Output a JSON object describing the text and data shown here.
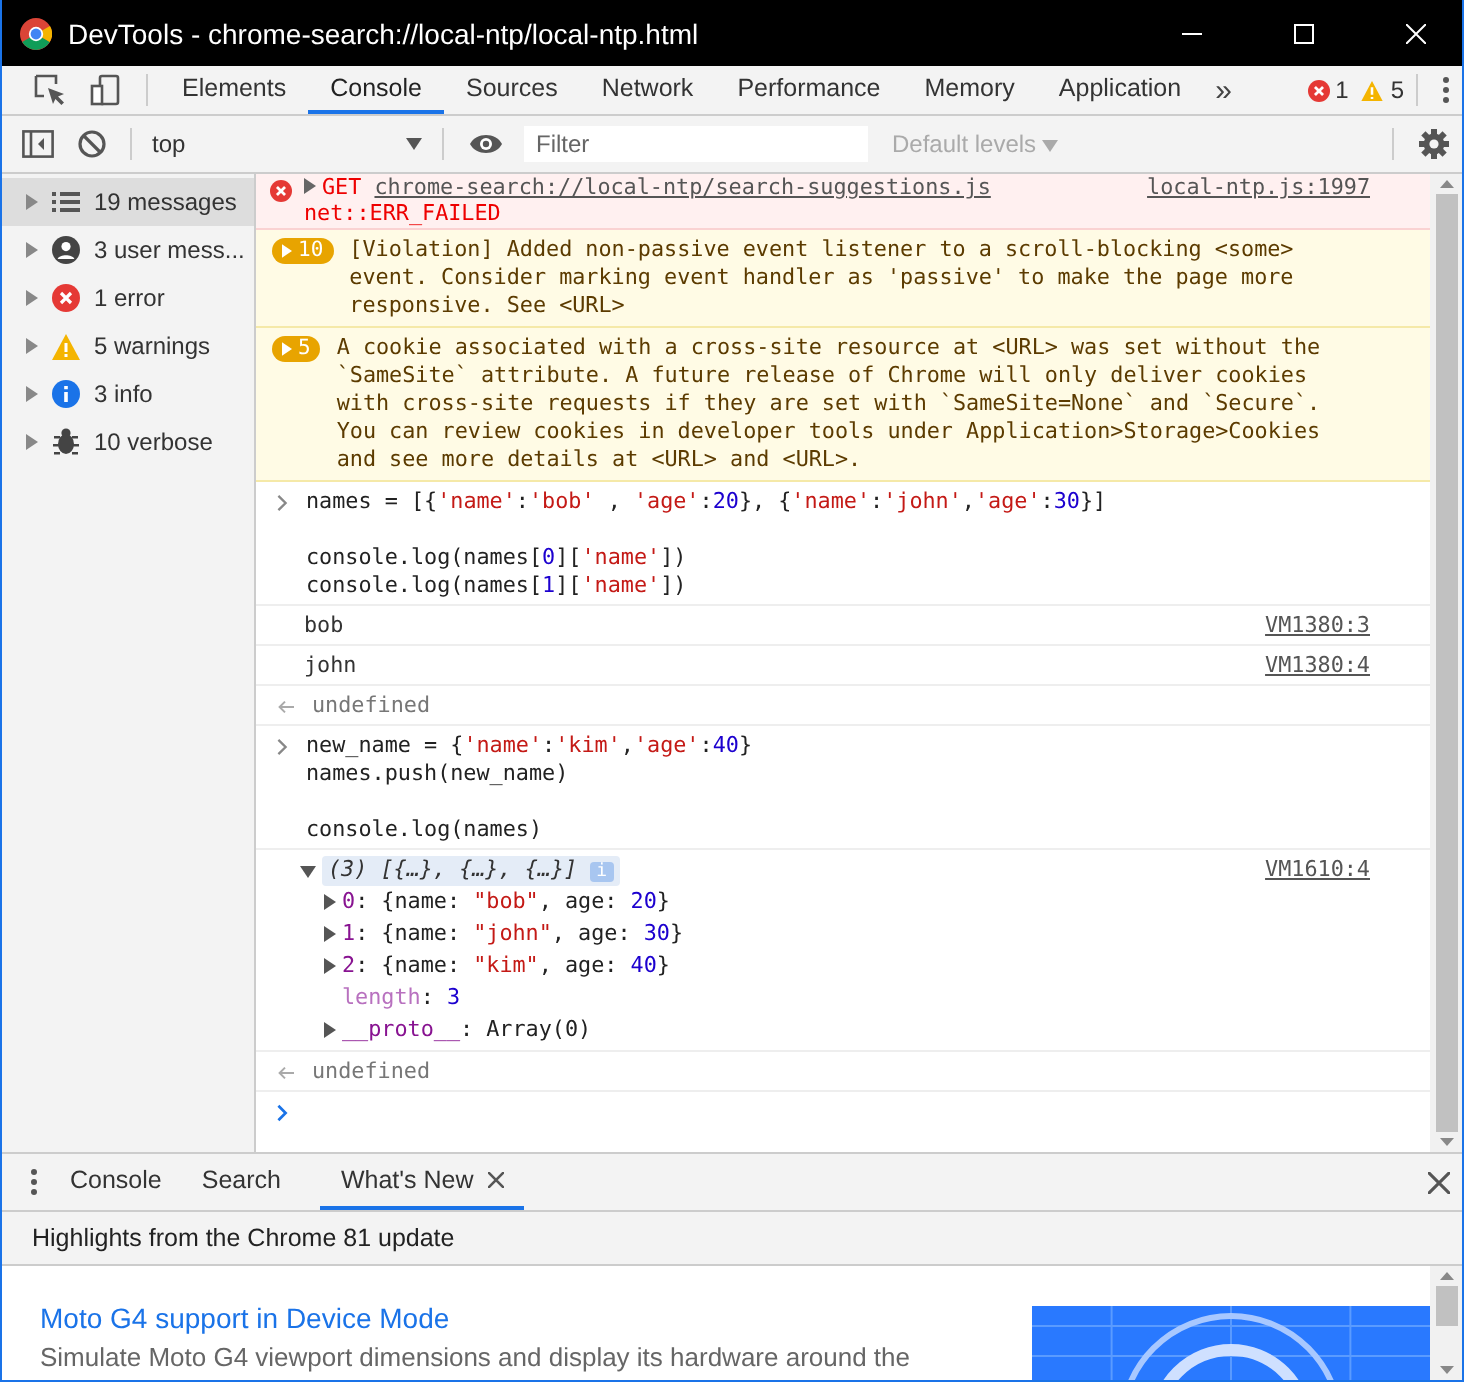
{
  "window": {
    "title": "DevTools - chrome-search://local-ntp/local-ntp.html"
  },
  "main_tabs": [
    {
      "label": "Elements",
      "selected": false
    },
    {
      "label": "Console",
      "selected": true
    },
    {
      "label": "Sources",
      "selected": false
    },
    {
      "label": "Network",
      "selected": false
    },
    {
      "label": "Performance",
      "selected": false
    },
    {
      "label": "Memory",
      "selected": false
    },
    {
      "label": "Application",
      "selected": false
    }
  ],
  "more_tabs": "»",
  "error_count": "1",
  "warning_count": "5",
  "toolbar": {
    "context": "top",
    "filter_placeholder": "Filter",
    "levels": "Default levels"
  },
  "sidebar": [
    {
      "kind": "messages",
      "label": "19 messages",
      "selected": true
    },
    {
      "kind": "user",
      "label": "3 user mess...",
      "selected": false
    },
    {
      "kind": "error",
      "label": "1 error",
      "selected": false
    },
    {
      "kind": "warning",
      "label": "5 warnings",
      "selected": false
    },
    {
      "kind": "info",
      "label": "3 info",
      "selected": false
    },
    {
      "kind": "verbose",
      "label": "10 verbose",
      "selected": false
    }
  ],
  "messages": [
    {
      "kind": "error",
      "method": "GET",
      "url": "chrome-search://local-ntp/search-suggestions.js",
      "detail": "net::ERR_FAILED",
      "source": "local-ntp.js:1997"
    },
    {
      "kind": "warning",
      "count": "10",
      "lines": [
        "[Violation] Added non-passive event listener to a scroll-blocking <some>",
        "event. Consider marking event handler as 'passive' to make the page more",
        "responsive. See <URL>"
      ]
    },
    {
      "kind": "warning",
      "count": "5",
      "lines": [
        "A cookie associated with a cross-site resource at <URL> was set without the",
        "`SameSite` attribute. A future release of Chrome will only deliver cookies",
        "with cross-site requests if they are set with `SameSite=None` and `Secure`.",
        "You can review cookies in developer tools under Application>Storage>Cookies",
        "and see more details at <URL> and <URL>."
      ]
    },
    {
      "kind": "input",
      "blocks": [
        [
          {
            "tokens": [
              {
                "kind": "plain",
                "text": "names = [{"
              },
              {
                "kind": "string",
                "text": "'name'"
              },
              {
                "kind": "plain",
                "text": ":"
              },
              {
                "kind": "string",
                "text": "'bob'"
              },
              {
                "kind": "plain",
                "text": " , "
              },
              {
                "kind": "string",
                "text": "'age'"
              },
              {
                "kind": "plain",
                "text": ":"
              },
              {
                "kind": "number",
                "text": "20"
              },
              {
                "kind": "plain",
                "text": "}, {"
              },
              {
                "kind": "string",
                "text": "'name'"
              },
              {
                "kind": "plain",
                "text": ":"
              },
              {
                "kind": "string",
                "text": "'john'"
              },
              {
                "kind": "plain",
                "text": ","
              },
              {
                "kind": "string",
                "text": "'age'"
              },
              {
                "kind": "plain",
                "text": ":"
              },
              {
                "kind": "number",
                "text": "30"
              },
              {
                "kind": "plain",
                "text": "}]"
              }
            ]
          }
        ],
        [
          {
            "tokens": [
              {
                "kind": "plain",
                "text": "console.log(names["
              },
              {
                "kind": "number",
                "text": "0"
              },
              {
                "kind": "plain",
                "text": "]["
              },
              {
                "kind": "string",
                "text": "'name'"
              },
              {
                "kind": "plain",
                "text": "])"
              }
            ]
          },
          {
            "tokens": [
              {
                "kind": "plain",
                "text": "console.log(names["
              },
              {
                "kind": "number",
                "text": "1"
              },
              {
                "kind": "plain",
                "text": "]["
              },
              {
                "kind": "string",
                "text": "'name'"
              },
              {
                "kind": "plain",
                "text": "])"
              }
            ]
          }
        ]
      ]
    },
    {
      "kind": "log",
      "text": "bob",
      "source": "VM1380:3"
    },
    {
      "kind": "log",
      "text": "john",
      "source": "VM1380:4"
    },
    {
      "kind": "result",
      "text": "undefined"
    },
    {
      "kind": "input",
      "blocks": [
        [
          {
            "tokens": [
              {
                "kind": "plain",
                "text": "new_name = {"
              },
              {
                "kind": "string",
                "text": "'name'"
              },
              {
                "kind": "plain",
                "text": ":"
              },
              {
                "kind": "string",
                "text": "'kim'"
              },
              {
                "kind": "plain",
                "text": ","
              },
              {
                "kind": "string",
                "text": "'age'"
              },
              {
                "kind": "plain",
                "text": ":"
              },
              {
                "kind": "number",
                "text": "40"
              },
              {
                "kind": "plain",
                "text": "}"
              }
            ]
          },
          {
            "tokens": [
              {
                "kind": "plain",
                "text": "names.push(new_name)"
              }
            ]
          }
        ],
        [
          {
            "tokens": [
              {
                "kind": "plain",
                "text": "console.log(names)"
              }
            ]
          }
        ]
      ]
    },
    {
      "kind": "object",
      "summary": "(3) [{…}, {…}, {…}]",
      "info": "i",
      "source": "VM1610:4",
      "expanded": true,
      "entries": [
        {
          "expandable": true,
          "key": "0",
          "value": [
            {
              "kind": "plain",
              "text": ": {name: "
            },
            {
              "kind": "string",
              "text": "\"bob\""
            },
            {
              "kind": "plain",
              "text": ", age: "
            },
            {
              "kind": "number",
              "text": "20"
            },
            {
              "kind": "plain",
              "text": "}"
            }
          ]
        },
        {
          "expandable": true,
          "key": "1",
          "value": [
            {
              "kind": "plain",
              "text": ": {name: "
            },
            {
              "kind": "string",
              "text": "\"john\""
            },
            {
              "kind": "plain",
              "text": ", age: "
            },
            {
              "kind": "number",
              "text": "30"
            },
            {
              "kind": "plain",
              "text": "}"
            }
          ]
        },
        {
          "expandable": true,
          "key": "2",
          "value": [
            {
              "kind": "plain",
              "text": ": {name: "
            },
            {
              "kind": "string",
              "text": "\"kim\""
            },
            {
              "kind": "plain",
              "text": ", age: "
            },
            {
              "kind": "number",
              "text": "40"
            },
            {
              "kind": "plain",
              "text": "}"
            }
          ]
        },
        {
          "expandable": false,
          "key": "length",
          "value": [
            {
              "kind": "plain",
              "text": ": "
            },
            {
              "kind": "number",
              "text": "3"
            }
          ]
        },
        {
          "expandable": true,
          "key": "__proto__",
          "value": [
            {
              "kind": "plain",
              "text": ": Array(0)"
            }
          ]
        }
      ]
    },
    {
      "kind": "result",
      "text": "undefined"
    },
    {
      "kind": "prompt"
    }
  ],
  "drawer": {
    "tabs": [
      {
        "label": "Console",
        "selected": false,
        "closable": false
      },
      {
        "label": "Search",
        "selected": false,
        "closable": false
      },
      {
        "label": "What's New",
        "selected": true,
        "closable": true
      }
    ],
    "header": "Highlights from the Chrome 81 update",
    "article": {
      "title": "Moto G4 support in Device Mode",
      "description": "Simulate Moto G4 viewport dimensions and display its hardware around the"
    }
  }
}
